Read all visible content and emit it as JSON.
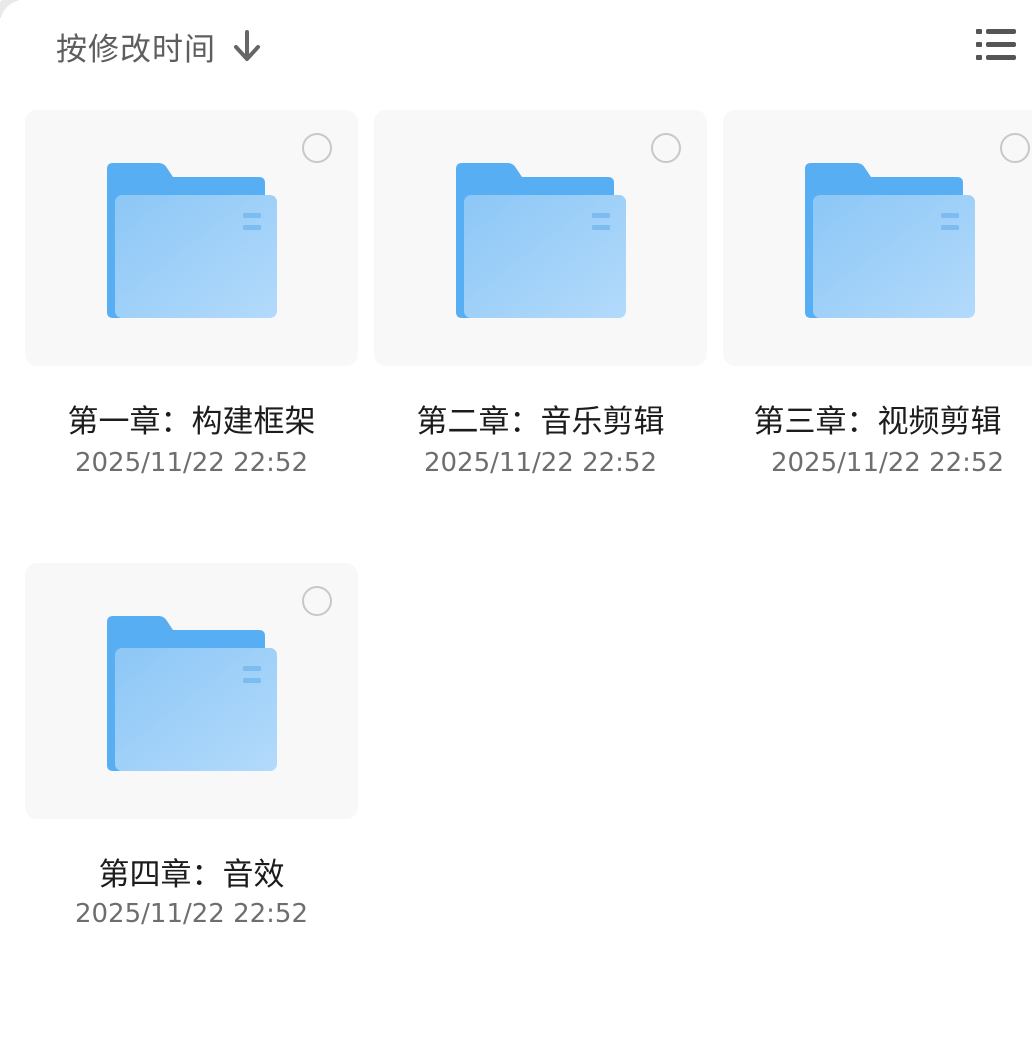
{
  "sort": {
    "label": "按修改时间",
    "direction_icon": "arrow-down-icon"
  },
  "view_toggle": {
    "icon": "list-view-icon"
  },
  "colors": {
    "folder_back": "#58aef3",
    "folder_front_start": "#8cc7f6",
    "folder_front_end": "#b3dafb",
    "card_bg": "#f8f8f8",
    "text_primary": "#1c1c1c",
    "text_secondary": "#6e6e6e"
  },
  "folders": [
    {
      "name": "第一章：构建框架",
      "modified": "2025/11/22 22:52",
      "icon": "folder-icon"
    },
    {
      "name": "第二章：音乐剪辑",
      "modified": "2025/11/22 22:52",
      "icon": "folder-icon"
    },
    {
      "name": "第三章：视频剪辑",
      "modified": "2025/11/22 22:52",
      "icon": "folder-icon"
    },
    {
      "name": "第四章：音效",
      "modified": "2025/11/22 22:52",
      "icon": "folder-icon"
    }
  ]
}
